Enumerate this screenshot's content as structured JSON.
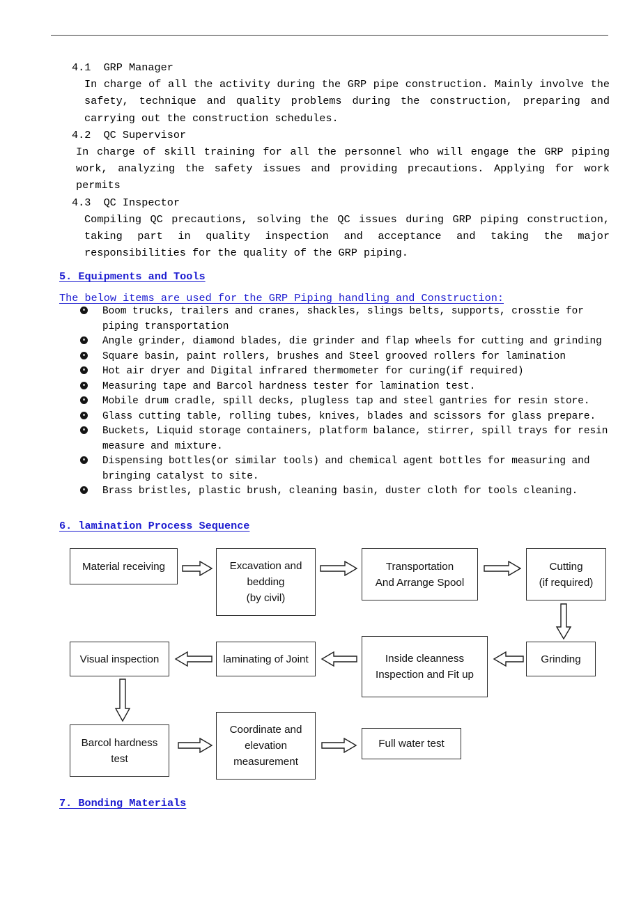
{
  "document": {
    "sections": [
      {
        "id": "4.1",
        "number": "4.1  GRP Manager",
        "body": "In charge of all the activity during the GRP pipe construction. Mainly involve the safety, technique and quality problems during the construction, preparing and carrying out the construction schedules."
      },
      {
        "id": "4.2",
        "number": "4.2  QC Supervisor",
        "body": "In charge of skill training for all the personnel who will engage the GRP piping work, analyzing the safety issues and providing precautions. Applying for work permits"
      },
      {
        "id": "4.3",
        "number": "4.3  QC Inspector",
        "body": "Compiling QC precautions, solving the QC issues during GRP piping construction, taking part in quality inspection and acceptance and taking the major responsibilities for the quality of the GRP piping."
      }
    ],
    "heading_5": "5. Equipments and Tools",
    "intro_5": "The below items are used for the GRP Piping handling and Construction:",
    "equipment_items": [
      "Boom trucks, trailers and cranes, shackles, slings belts, supports, crosstie for piping transportation",
      "Angle grinder, diamond blades, die grinder and flap wheels for cutting and grinding",
      "Square basin, paint rollers, brushes and Steel grooved rollers for lamination",
      "Hot air dryer and Digital infrared thermometer for curing(if required)",
      "Measuring tape and Barcol hardness tester for lamination test.",
      "Mobile drum cradle, spill decks, plugless tap and steel gantries for resin store.",
      "Glass cutting table, rolling tubes, knives, blades and scissors for glass prepare.",
      "Buckets, Liquid storage containers, platform balance, stirrer, spill trays for resin measure and mixture.",
      "Dispensing bottles(or similar tools) and chemical agent bottles for measuring and bringing catalyst to site.",
      "Brass bristles, plastic brush, cleaning basin, duster cloth for tools cleaning."
    ],
    "heading_6": "6. lamination Process Sequence",
    "heading_7": "7. Bonding Materials",
    "colors": {
      "heading_blue": "#1c1cd0",
      "text_black": "#000000",
      "box_border": "#2b2b2b"
    }
  },
  "flowchart": {
    "boxes": [
      {
        "id": "material-receiving",
        "label": "Material receiving"
      },
      {
        "id": "excavation-bedding",
        "label": "Excavation and\nbedding\n(by civil)"
      },
      {
        "id": "transportation-spool",
        "label": "Transportation\nAnd Arrange Spool"
      },
      {
        "id": "cutting",
        "label": "Cutting\n(if required)"
      },
      {
        "id": "grinding",
        "label": "Grinding"
      },
      {
        "id": "inside-cleanness",
        "label": "Inside cleanness\nInspection and    Fit up"
      },
      {
        "id": "laminating-joint",
        "label": "laminating of Joint"
      },
      {
        "id": "visual-inspection",
        "label": "Visual inspection"
      },
      {
        "id": "barcol-hardness",
        "label": "Barcol hardness\ntest"
      },
      {
        "id": "coordinate-elevation",
        "label": "Coordinate and\nelevation\nmeasurement"
      },
      {
        "id": "full-water-test",
        "label": "Full water test"
      }
    ],
    "connectors": [
      {
        "from": "material-receiving",
        "to": "excavation-bedding",
        "direction": "right"
      },
      {
        "from": "excavation-bedding",
        "to": "transportation-spool",
        "direction": "right"
      },
      {
        "from": "transportation-spool",
        "to": "cutting",
        "direction": "right"
      },
      {
        "from": "cutting",
        "to": "grinding",
        "direction": "down"
      },
      {
        "from": "grinding",
        "to": "inside-cleanness",
        "direction": "left"
      },
      {
        "from": "inside-cleanness",
        "to": "laminating-joint",
        "direction": "left"
      },
      {
        "from": "laminating-joint",
        "to": "visual-inspection",
        "direction": "left"
      },
      {
        "from": "visual-inspection",
        "to": "barcol-hardness",
        "direction": "down"
      },
      {
        "from": "barcol-hardness",
        "to": "coordinate-elevation",
        "direction": "right"
      },
      {
        "from": "coordinate-elevation",
        "to": "full-water-test",
        "direction": "right"
      }
    ]
  }
}
